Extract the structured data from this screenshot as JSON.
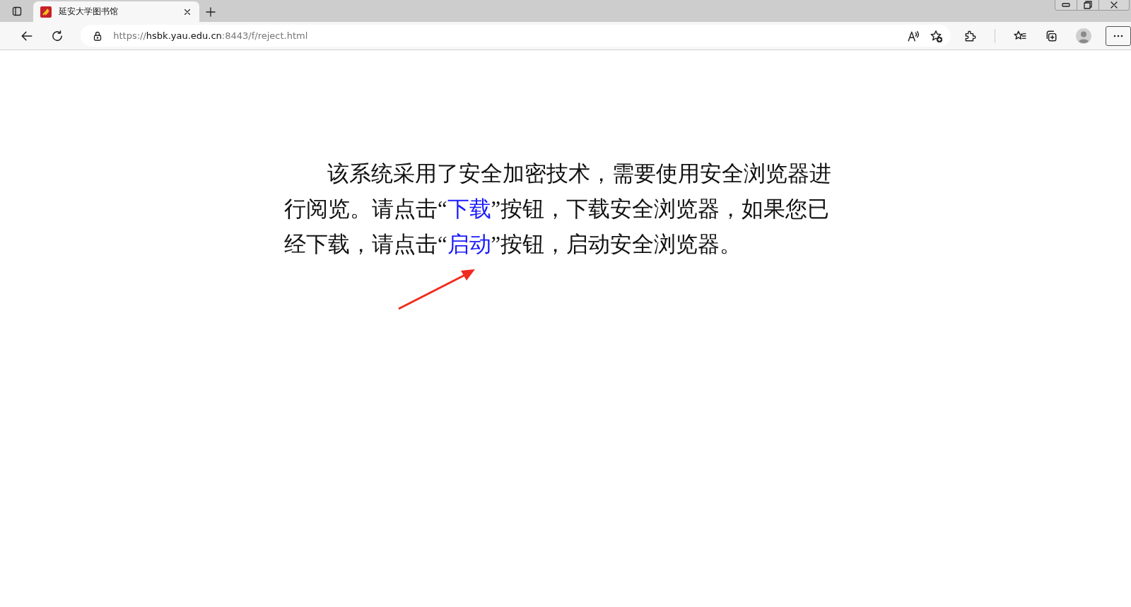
{
  "tab": {
    "title": "延安大学图书馆",
    "selected": true
  },
  "address_bar": {
    "scheme": "https://",
    "host": "hsbk.yau.edu.cn",
    "path": ":8443/f/reject.html"
  },
  "paragraph": [
    {
      "kind": "text",
      "text": "该系统采用了安全加密技术，需要使用安全浏览器进行阅览。请点击“"
    },
    {
      "kind": "link",
      "text": "下载"
    },
    {
      "kind": "text",
      "text": "”按钮，下载安全浏览器，如果您已经下载，请点击“"
    },
    {
      "kind": "link",
      "text": "启动"
    },
    {
      "kind": "text",
      "text": "”按钮，启动安全浏览器。"
    }
  ]
}
